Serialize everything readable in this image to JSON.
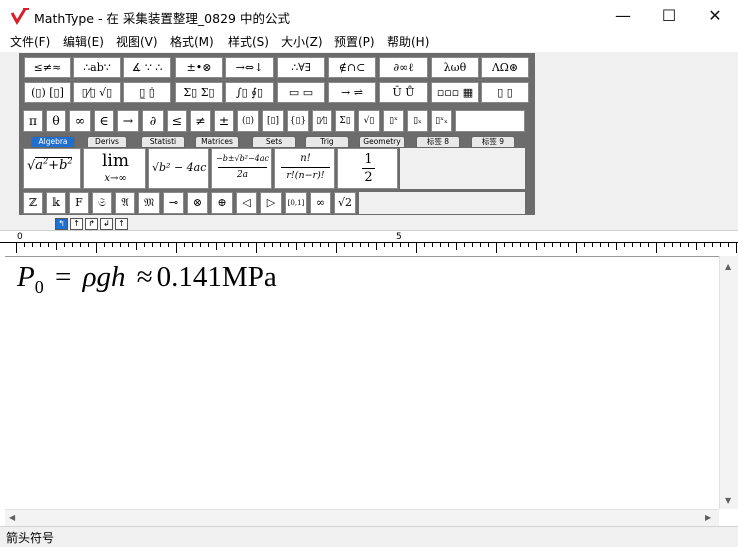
{
  "window": {
    "app_name": "MathType",
    "title": "MathType - 在 采集装置整理_0829 中的公式",
    "controls": {
      "minimize": "—",
      "maximize": "☐",
      "close": "✕"
    }
  },
  "menu": [
    "文件(F)",
    "编辑(E)",
    "视图(V)",
    "格式(M)",
    "样式(S)",
    "大小(Z)",
    "预置(P)",
    "帮助(H)"
  ],
  "palette_row1": [
    "≤≠≈",
    "∴ab∵",
    "∡ ∵ ∴",
    "±•⊗",
    "→⇔↓",
    "∴∀∃",
    "∉∩⊂",
    "∂∞ℓ",
    "λωθ",
    "ΛΩ⊛"
  ],
  "palette_row2": [
    "(▯) [▯]",
    "▯⁄▯ √▯",
    "▯̲ ▯̇",
    "Σ▯ Σ▯",
    "∫▯ ∮▯",
    "▭ ▭",
    "→ ⇌",
    "Ū Ů",
    "▫▫▫ ▦",
    "▯ ▯"
  ],
  "symbols_bar": [
    "π",
    "θ",
    "∞",
    "∈",
    "→",
    "∂",
    "≤",
    "≠",
    "±",
    "(▯)",
    "[▯]",
    "{▯}",
    "▯⁄▯",
    "Σ▯",
    "√▯",
    "▯ˣ",
    "▯ₓ",
    "▯ˣₓ"
  ],
  "tabs": [
    "Algebra",
    "Derivs",
    "Statisti",
    "Matrices",
    "Sets",
    "Trig",
    "Geometry",
    "标签 8",
    "标签 9"
  ],
  "templates": {
    "sqrt_sum": {
      "a": "a",
      "exp": "2",
      "plus": "+",
      "b": "b"
    },
    "limit": {
      "top": "lim",
      "sub": "x→∞"
    },
    "sqrt_disc": "√b² − 4ac",
    "quadratic": {
      "num": "−b±√b²−4ac",
      "den": "2a"
    },
    "perm": {
      "num": "n!",
      "den": "r!(n−r)!"
    },
    "half": {
      "num": "1",
      "den": "2"
    }
  },
  "bottom_row": [
    "ℤ",
    "𝕜",
    "F",
    "𝔖",
    "𝔄",
    "𝔐",
    "⊸",
    "⊗",
    "⊕",
    "◁",
    "▷",
    "[0,1]",
    "∞",
    "√2"
  ],
  "small_tabs": [
    "↰",
    "↑",
    "↱",
    "↲",
    "↑"
  ],
  "ruler": {
    "label_0": "0",
    "label_5": "5"
  },
  "equation": {
    "P": "P",
    "sub": "0",
    "eq": "=",
    "rho": "ρ",
    "g": "g",
    "h": "h",
    "approx": "≈",
    "value": "0.141",
    "unit": "MPa"
  },
  "status_text": "箭头符号"
}
